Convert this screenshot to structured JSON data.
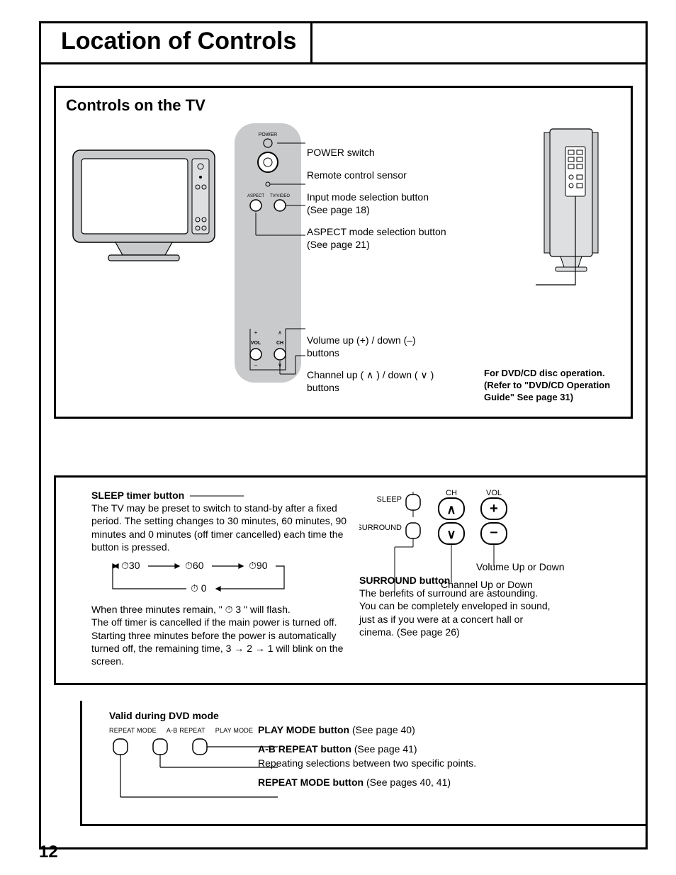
{
  "page_number": "12",
  "title": "Location of Controls",
  "section1": {
    "heading": "Controls on the TV",
    "labels": {
      "power": "POWER switch",
      "sensor": "Remote control sensor",
      "input": "Input mode selection button (See page 18)",
      "aspect": "ASPECT mode selection button (See page 21)",
      "volume": "Volume up (+) / down (–) buttons",
      "channel": "Channel up ( ∧ ) / down ( ∨ ) buttons"
    },
    "panel_text": {
      "power": "POWER",
      "aspect": "ASPECT",
      "tvvideo": "TV/VIDEO",
      "vol": "VOL",
      "ch": "CH"
    },
    "dvd_note": "For DVD/CD disc operation. (Refer to \"DVD/CD Operation Guide\" See page 31)"
  },
  "section2": {
    "sleep": {
      "heading": "SLEEP timer button",
      "p1": "The TV may be preset to switch to stand-by after a fixed period. The setting changes to 30 minutes, 60 minutes, 90 minutes and 0 minutes (off timer cancelled) each time the button is pressed.",
      "timer_values": [
        "30",
        "60",
        "90",
        "0"
      ],
      "p2": "When three minutes remain, \" ⏱ 3 \" will flash.",
      "p3": "The off timer is cancelled if the main power is turned off.",
      "p4": "Starting three minutes before the power is automatically turned off, the remaining time, 3 → 2 → 1 will blink on the screen."
    },
    "remote": {
      "sleep_label": "SLEEP",
      "surround_label": "SURROUND",
      "ch_label": "CH",
      "vol_label": "VOL",
      "vol_caption": "Volume Up or Down",
      "ch_caption": "Channel Up or Down"
    },
    "surround": {
      "heading": "SURROUND button",
      "body": "The benefits of surround are astounding. You can be completely enveloped in sound, just as if you were at a concert hall or cinema. (See page 26)"
    }
  },
  "section3": {
    "heading": "Valid during DVD mode",
    "small_labels": [
      "REPEAT MODE",
      "A-B REPEAT",
      "PLAY MODE"
    ],
    "play": {
      "b": "PLAY MODE button",
      "rest": " (See page 40)"
    },
    "ab": {
      "b": "A-B REPEAT button",
      "rest": " (See page 41)",
      "sub": "Repeating selections between two specific points."
    },
    "rep": {
      "b": "REPEAT MODE button",
      "rest": " (See pages 40, 41)"
    }
  }
}
